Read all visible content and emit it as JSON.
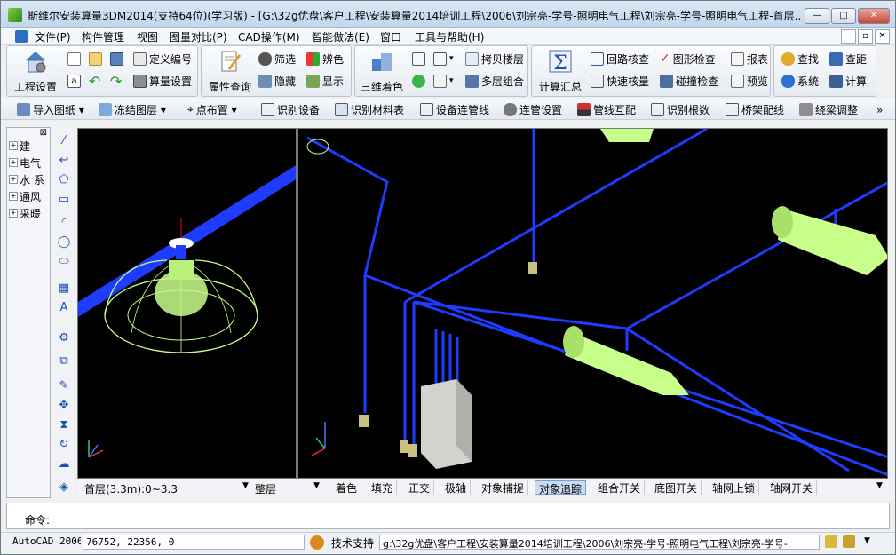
{
  "window": {
    "title": "斯维尔安装算量3DM2014(支持64位)(学习版) - [G:\\32g优盘\\客户工程\\安装算量2014培训工程\\2006\\刘宗亮-学号-照明电气工程\\刘宗亮-学号-照明电气工程-首层...",
    "minimize": "—",
    "maximize": "□",
    "close": "✕"
  },
  "menu": {
    "items": [
      "文件(P)",
      "构件管理",
      "视图",
      "图量对比(P)",
      "CAD操作(M)",
      "智能做法(E)",
      "窗口",
      "工具与帮助(H)"
    ],
    "mdi_buttons": [
      "–",
      "▫",
      "✕"
    ]
  },
  "ribbon": {
    "project_settings": "工程设置",
    "define_number": "定义编号",
    "calc_settings": "算量设置",
    "attribute_query": "属性查询",
    "filter": "筛选",
    "distinguish_color": "辨色",
    "hide": "隐藏",
    "display": "显示",
    "color_3d": "三维着色",
    "copy_floor": "拷贝楼层",
    "multi_combine": "多层组合",
    "calc_summary": "计算汇总",
    "loop_check": "回路核查",
    "quick_check": "快速核量",
    "graphic_check": "图形检查",
    "collision_check": "碰撞检查",
    "report": "报表",
    "preview": "预览",
    "find": "查找",
    "system": "系统",
    "measure_distance": "查距",
    "calculate": "计算"
  },
  "toolbar2": {
    "items": [
      "导入图纸",
      "冻结图层",
      "点布置",
      "识别设备",
      "识别材料表",
      "设备连管线",
      "连管设置",
      "管线互配",
      "识别根数",
      "桥架配线",
      "绕梁调整"
    ],
    "more": "»"
  },
  "nav": {
    "items": [
      "建",
      "电气",
      "水 系",
      "通风",
      "采暖"
    ]
  },
  "status1": {
    "floor": "首层(3.3m):0~3.3",
    "layer": "整层",
    "buttons": [
      "着色",
      "填充",
      "正交",
      "极轴",
      "对象捕捉",
      "对象追踪",
      "组合开关",
      "底图开关",
      "轴网上锁",
      "轴网开关"
    ],
    "active": "对象追踪"
  },
  "command": {
    "label": "命令:"
  },
  "status2": {
    "cad_version": "AutoCAD 2006",
    "coords": "76752, 22356, 0",
    "support": "技术支持",
    "path": "g:\\32g优盘\\客户工程\\安装算量2014培训工程\\2006\\刘宗亮-学号-照明电气工程\\刘宗亮-学号-"
  },
  "colors": {
    "pipe_blue": "#1e3cff",
    "fixture_green": "#c8ff8a",
    "viewport_bg": "#000000",
    "accent": "#2f6fd0"
  }
}
